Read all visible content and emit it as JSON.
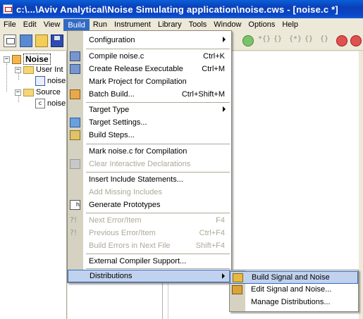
{
  "window": {
    "title": "c:\\...\\Aviv Analytical\\Noise Simulating application\\noise.cws - [noise.c *]"
  },
  "menubar": {
    "items": [
      "File",
      "Edit",
      "View",
      "Build",
      "Run",
      "Instrument",
      "Library",
      "Tools",
      "Window",
      "Options",
      "Help"
    ],
    "active": "Build"
  },
  "toolbar": {
    "right_glyphs": [
      "*{}",
      "{}",
      "{*}",
      "{}",
      "{}"
    ]
  },
  "tree": {
    "root": "Noise",
    "folder1": "User Int",
    "file1": "noise",
    "folder2": "Source",
    "file2": "noise"
  },
  "build_menu": {
    "configuration": "Configuration",
    "compile": "Compile noise.c",
    "compile_shortcut": "Ctrl+K",
    "create_release": "Create Release Executable",
    "create_release_shortcut": "Ctrl+M",
    "mark_project": "Mark Project for Compilation",
    "batch_build": "Batch Build...",
    "batch_build_shortcut": "Ctrl+Shift+M",
    "target_type": "Target Type",
    "target_settings": "Target Settings...",
    "build_steps": "Build Steps...",
    "mark_noise": "Mark noise.c for Compilation",
    "clear_interactive": "Clear Interactive Declarations",
    "insert_include": "Insert Include Statements...",
    "add_missing": "Add Missing Includes",
    "generate_prototypes": "Generate Prototypes",
    "next_error": "Next Error/Item",
    "next_error_shortcut": "F4",
    "previous_error": "Previous Error/Item",
    "previous_error_shortcut": "Ctrl+F4",
    "build_errors": "Build Errors in Next File",
    "build_errors_shortcut": "Shift+F4",
    "external_compiler": "External Compiler Support...",
    "distributions": "Distributions"
  },
  "distributions_menu": {
    "build_signal": "Build Signal and Noise",
    "edit_signal": "Edit Signal and Noise...",
    "manage": "Manage Distributions..."
  },
  "colors": {
    "highlight_fill": "#c1d2ee",
    "highlight_border": "#316ac5",
    "disabled_text": "#aca899"
  }
}
